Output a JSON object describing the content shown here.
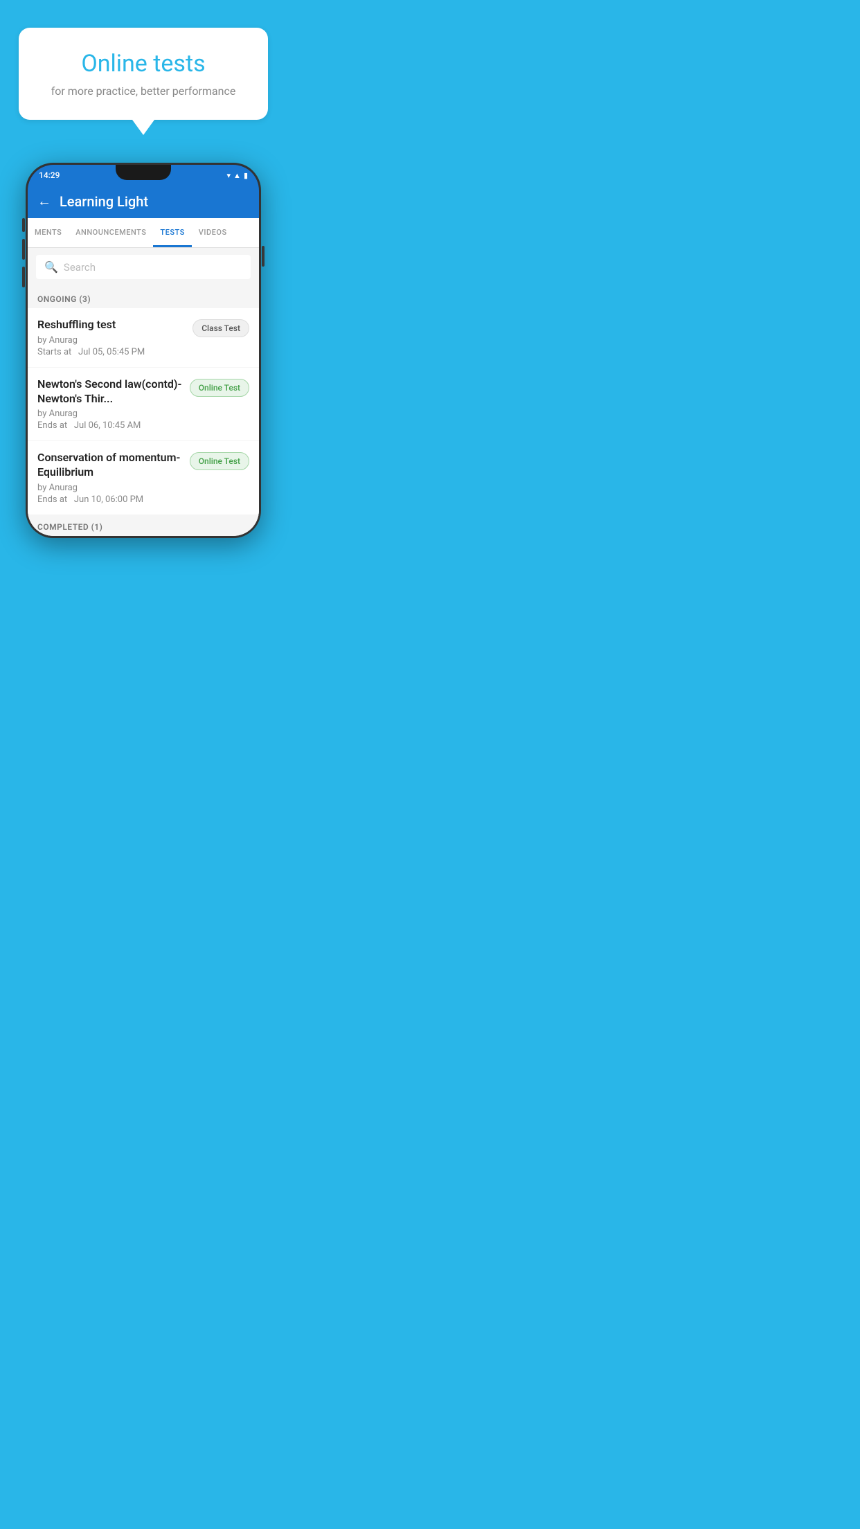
{
  "background_color": "#29B6E8",
  "speech_bubble": {
    "title": "Online tests",
    "subtitle": "for more practice, better performance"
  },
  "phone": {
    "status_bar": {
      "time": "14:29",
      "icons": [
        "wifi",
        "signal",
        "battery"
      ]
    },
    "header": {
      "title": "Learning Light",
      "back_label": "←"
    },
    "tabs": [
      {
        "label": "MENTS",
        "active": false
      },
      {
        "label": "ANNOUNCEMENTS",
        "active": false
      },
      {
        "label": "TESTS",
        "active": true
      },
      {
        "label": "VIDEOS",
        "active": false
      }
    ],
    "search": {
      "placeholder": "Search"
    },
    "ongoing_section": {
      "label": "ONGOING (3)",
      "items": [
        {
          "title": "Reshuffling test",
          "by": "by Anurag",
          "date_label": "Starts at",
          "date": "Jul 05, 05:45 PM",
          "badge": "Class Test",
          "badge_type": "class"
        },
        {
          "title": "Newton's Second law(contd)-Newton's Thir...",
          "by": "by Anurag",
          "date_label": "Ends at",
          "date": "Jul 06, 10:45 AM",
          "badge": "Online Test",
          "badge_type": "online"
        },
        {
          "title": "Conservation of momentum-Equilibrium",
          "by": "by Anurag",
          "date_label": "Ends at",
          "date": "Jun 10, 06:00 PM",
          "badge": "Online Test",
          "badge_type": "online"
        }
      ]
    },
    "completed_section": {
      "label": "COMPLETED (1)"
    }
  }
}
